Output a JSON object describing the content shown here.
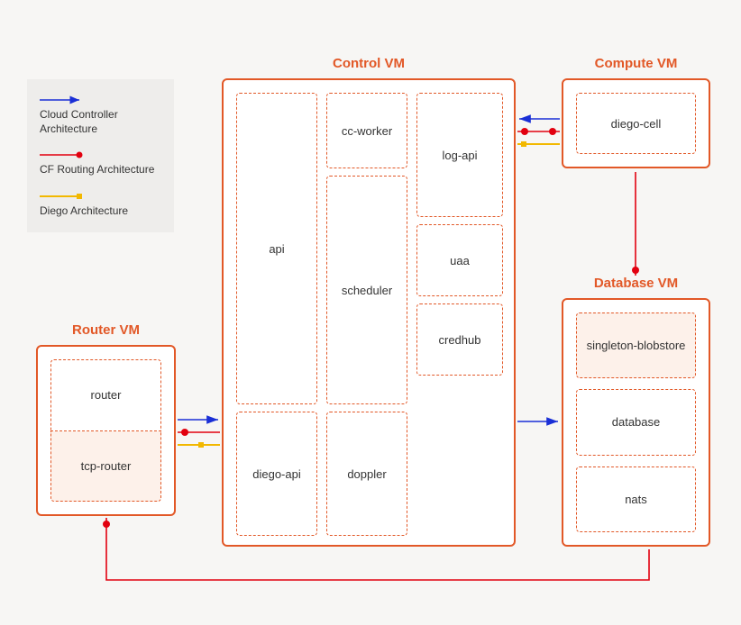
{
  "legend": {
    "items": [
      {
        "label": "Cloud Controller Architecture",
        "kind": "arrow-blue"
      },
      {
        "label": "CF Routing Architecture",
        "kind": "line-red-dot"
      },
      {
        "label": "Diego Architecture",
        "kind": "line-yellow-square"
      }
    ]
  },
  "vms": {
    "control": {
      "title": "Control VM",
      "components": {
        "api": "api",
        "diego_api": "diego-api",
        "cc_worker": "cc-worker",
        "scheduler": "scheduler",
        "doppler": "doppler",
        "log_api": "log-api",
        "uaa": "uaa",
        "credhub": "credhub"
      }
    },
    "compute": {
      "title": "Compute VM",
      "components": {
        "diego_cell": "diego-cell"
      }
    },
    "router": {
      "title": "Router VM",
      "components": {
        "router": "router",
        "tcp_router": "tcp-router"
      }
    },
    "database": {
      "title": "Database VM",
      "components": {
        "blobstore": "singleton-blobstore",
        "database": "database",
        "nats": "nats"
      }
    }
  },
  "colors": {
    "orange": "#e25827",
    "blue": "#1a2fd6",
    "red": "#e2000f",
    "yellow": "#f2b800",
    "bg": "#f7f6f4"
  },
  "connections": [
    {
      "from": "router",
      "to": "control",
      "types": [
        "arrow-blue",
        "line-red-dot",
        "line-yellow-square"
      ]
    },
    {
      "from": "compute",
      "to": "control",
      "types": [
        "arrow-blue",
        "line-red-dot",
        "line-yellow-square"
      ]
    },
    {
      "from": "control",
      "to": "database",
      "types": [
        "arrow-blue"
      ]
    },
    {
      "from": "compute",
      "to": "database",
      "types": [
        "line-red-dot"
      ]
    },
    {
      "from": "router",
      "to": "database",
      "types": [
        "line-red-dot"
      ]
    }
  ]
}
